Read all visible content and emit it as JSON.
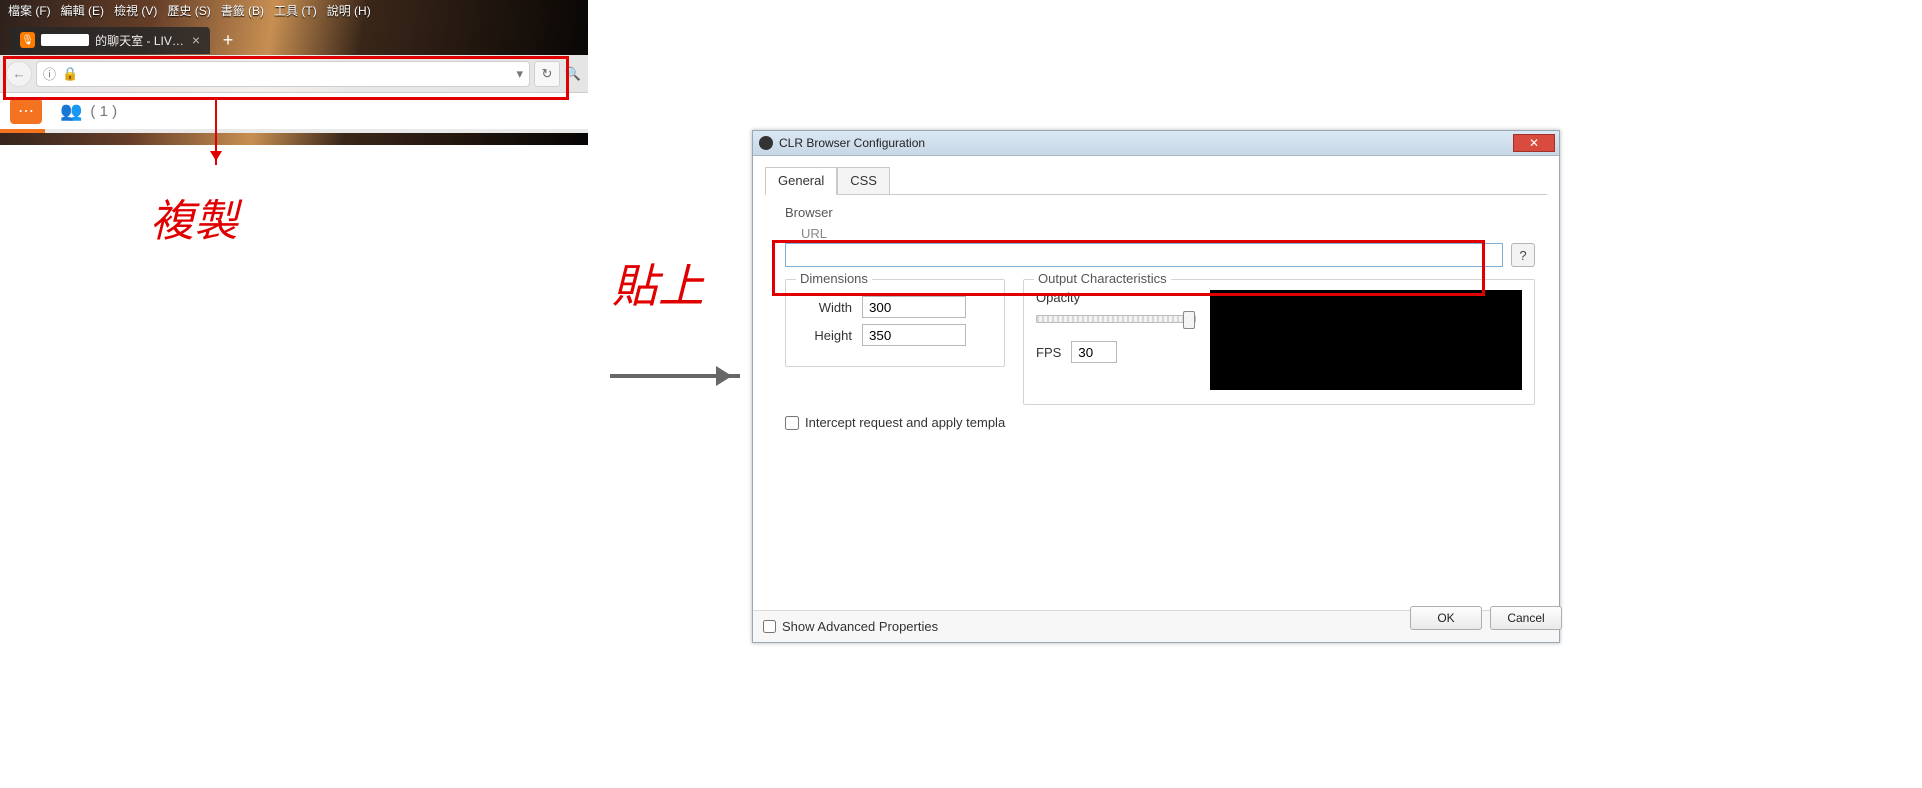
{
  "firefox": {
    "menubar": [
      "檔案 (F)",
      "編輯 (E)",
      "檢視 (V)",
      "歷史 (S)",
      "書籤 (B)",
      "工具 (T)",
      "說明 (H)"
    ],
    "tab_suffix": "的聊天室 - LIVE...",
    "tab_close": "×",
    "new_tab": "+",
    "back_symbol": "←",
    "info_symbol": "ⓘ",
    "lock_symbol": "🔒",
    "dropdown_symbol": "▾",
    "reload_symbol": "↻",
    "search_symbol": "🔍",
    "chat_bubble": "⋯",
    "users_icon": "👥",
    "user_count": "( 1 )"
  },
  "annotations": {
    "copy": "複製",
    "paste": "貼上"
  },
  "clr": {
    "title": "CLR Browser Configuration",
    "close": "✕",
    "tabs": {
      "general": "General",
      "css": "CSS"
    },
    "section_browser": "Browser",
    "url_label": "URL",
    "url_value": "",
    "help": "?",
    "dimensions_legend": "Dimensions",
    "width_label": "Width",
    "width_value": "300",
    "height_label": "Height",
    "height_value": "350",
    "output_legend": "Output Characteristics",
    "opacity_label": "Opacity",
    "fps_label": "FPS",
    "fps_value": "30",
    "intercept_label": "Intercept request and apply templa",
    "advanced_label": "Show Advanced Properties",
    "ok": "OK",
    "cancel": "Cancel"
  }
}
